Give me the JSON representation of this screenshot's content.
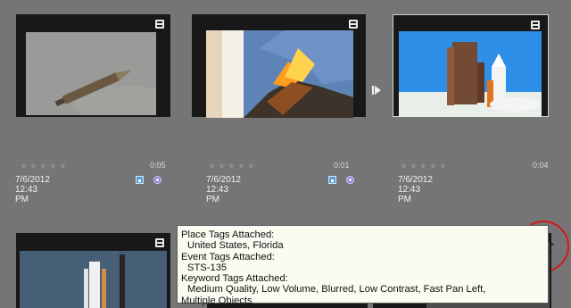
{
  "items": [
    {
      "rating": "★★★★★",
      "duration": "0:05",
      "date": "7/6/2012 12:43 PM"
    },
    {
      "rating": "★★★★★",
      "duration": "0:01",
      "date": "7/6/2012 12:43 PM"
    },
    {
      "rating": "★★★★★",
      "duration": "0:04",
      "date": "7/6/2012 12:43 PM"
    }
  ],
  "tooltip": {
    "place_heading": "Place Tags Attached:",
    "place_value": "United States, Florida",
    "event_heading": "Event Tags Attached:",
    "event_value": "STS-135",
    "keyword_heading": "Keyword Tags Attached:",
    "keyword_value_1": "Medium Quality, Low Volume, Blurred, Low Contrast, Fast Pan Left,",
    "keyword_value_2": "Multiple Objects"
  },
  "icons": {
    "film": "film-icon",
    "play_next": "chevron-right-icon",
    "tag": "tag-icon",
    "face": "face-icon",
    "cursor": "mouse-cursor-icon"
  },
  "colors": {
    "background": "#757575",
    "tooltip_bg": "#fbfbf2",
    "highlight_circle": "#d4181f",
    "thumb_frame": "#181818",
    "tag_blue": "#5a9fd8",
    "face_purple": "#8d7ce0"
  }
}
